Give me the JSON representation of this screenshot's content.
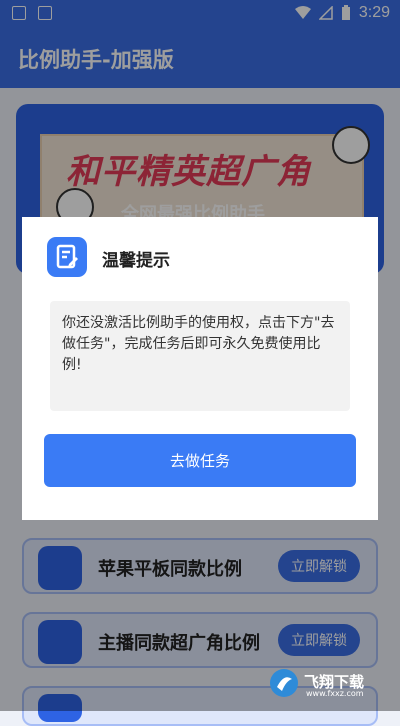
{
  "status_bar": {
    "time": "3:29"
  },
  "app_bar": {
    "title": "比例助手-加强版"
  },
  "banner": {
    "headline": "和平精英超广角",
    "subtitle": "全网最强比例助手"
  },
  "list_items": [
    {
      "label": "苹果平板同款比例",
      "action": "立即解锁"
    },
    {
      "label": "主播同款超广角比例",
      "action": "立即解锁"
    }
  ],
  "dialog": {
    "title": "温馨提示",
    "message": "你还没激活比例助手的使用权，点击下方\"去做任务\"，完成任务后即可永久免费使用比例!",
    "button": "去做任务"
  },
  "watermark": {
    "text": "飞翔下载",
    "url": "www.fxxz.com"
  },
  "colors": {
    "primary": "#3a6fe6",
    "button": "#3a7bf5"
  }
}
